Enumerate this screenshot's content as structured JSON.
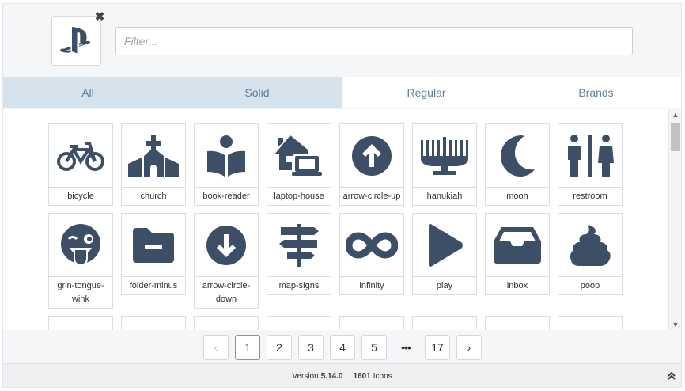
{
  "header": {
    "selected_icon": "playstation-icon",
    "clear_icon": "close-icon",
    "filter_placeholder": "Filter..."
  },
  "tabs": [
    {
      "label": "All",
      "active": true
    },
    {
      "label": "Solid",
      "active": true
    },
    {
      "label": "Regular",
      "active": false
    },
    {
      "label": "Brands",
      "active": false
    }
  ],
  "icons": [
    {
      "label": "bicycle",
      "icon": "bicycle-icon"
    },
    {
      "label": "church",
      "icon": "church-icon"
    },
    {
      "label": "book-reader",
      "icon": "book-reader-icon"
    },
    {
      "label": "laptop-house",
      "icon": "laptop-house-icon"
    },
    {
      "label": "arrow-circle-up",
      "icon": "arrow-circle-up-icon"
    },
    {
      "label": "hanukiah",
      "icon": "hanukiah-icon"
    },
    {
      "label": "moon",
      "icon": "moon-icon"
    },
    {
      "label": "restroom",
      "icon": "restroom-icon"
    },
    {
      "label": "grin-tongue-wink",
      "icon": "grin-tongue-wink-icon"
    },
    {
      "label": "folder-minus",
      "icon": "folder-minus-icon"
    },
    {
      "label": "arrow-circle-down",
      "icon": "arrow-circle-down-icon"
    },
    {
      "label": "map-signs",
      "icon": "map-signs-icon"
    },
    {
      "label": "infinity",
      "icon": "infinity-icon"
    },
    {
      "label": "play",
      "icon": "play-icon"
    },
    {
      "label": "inbox",
      "icon": "inbox-icon"
    },
    {
      "label": "poop",
      "icon": "poop-icon"
    }
  ],
  "pagination": {
    "prev": "‹",
    "pages": [
      "1",
      "2",
      "3",
      "4",
      "5"
    ],
    "ellipsis": "•••",
    "last": "17",
    "next": "›",
    "current": "1"
  },
  "footer": {
    "version_label": "Version",
    "version": "5.14.0",
    "count": "1601",
    "count_label": "Icons"
  },
  "colors": {
    "icon": "#3d4f66",
    "tab_active_bg": "#d6e3ec",
    "tab_text": "#5f7f99",
    "pager_current": "#3a7fb0"
  }
}
